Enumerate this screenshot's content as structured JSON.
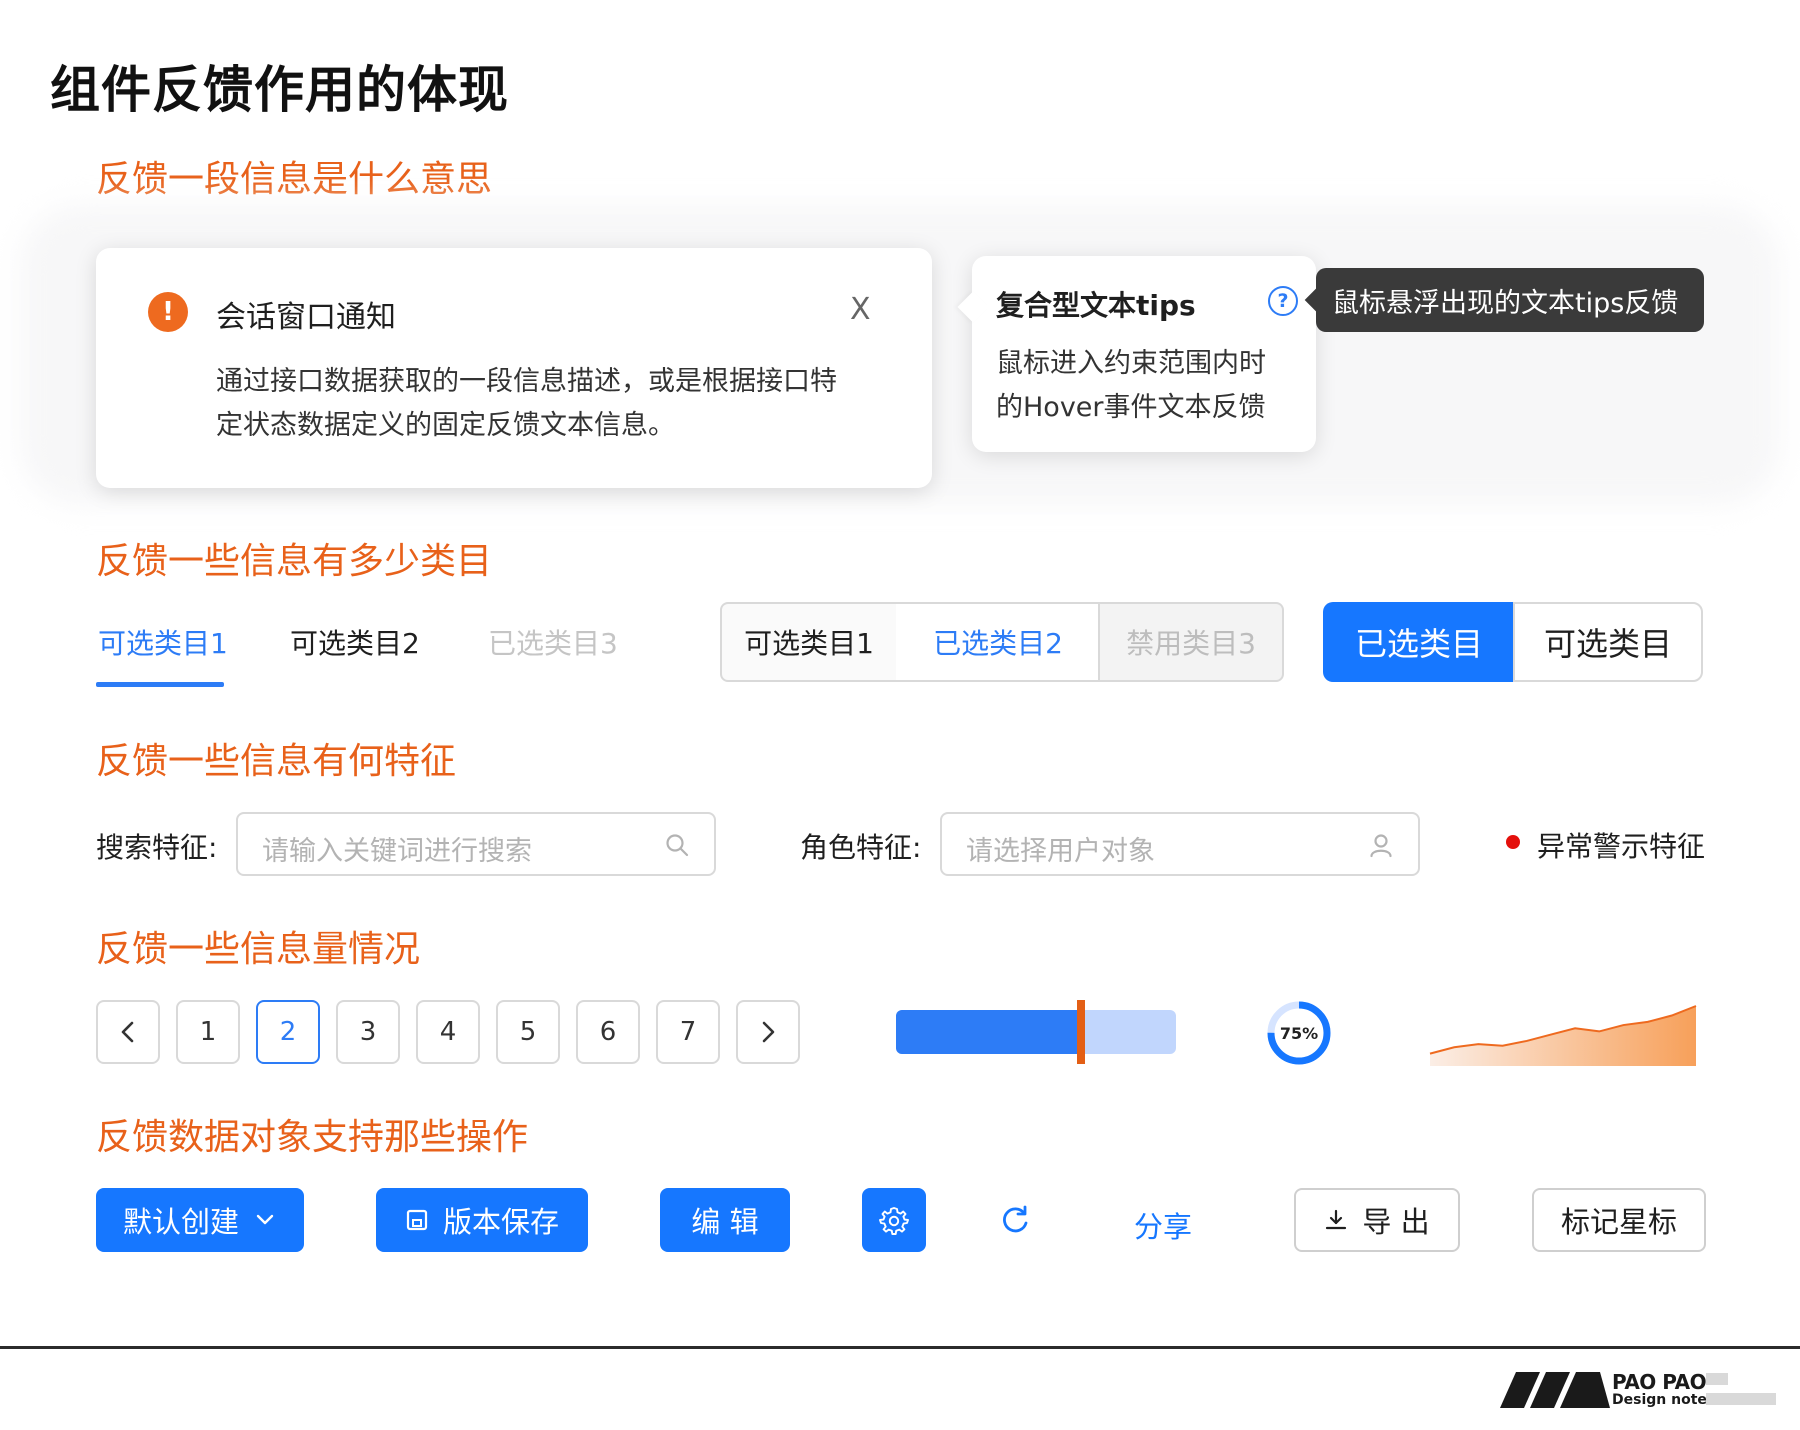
{
  "page_title": "组件反馈作用的体现",
  "sections": {
    "s1": "反馈一段信息是什么意思",
    "s2": "反馈一些信息有多少类目",
    "s3": "反馈一些信息有何特征",
    "s4": "反馈一些信息量情况",
    "s5": "反馈数据对象支持那些操作"
  },
  "notification": {
    "icon": "exclamation-icon",
    "icon_glyph": "!",
    "title": "会话窗口通知",
    "close_glyph": "X",
    "body_line1": "通过接口数据获取的一段信息描述，或是根据接口特",
    "body_line2": "定状态数据定义的固定反馈文本信息。"
  },
  "tip_card": {
    "title": "复合型文本tips",
    "help_glyph": "?",
    "body_line1": "鼠标进入约束范围内时",
    "body_line2": "的Hover事件文本反馈"
  },
  "hover_tooltip": "鼠标悬浮出现的文本tips反馈",
  "tabs": [
    {
      "label": "可选类目1",
      "state": "active"
    },
    {
      "label": "可选类目2",
      "state": "normal"
    },
    {
      "label": "已选类目3",
      "state": "disabled"
    }
  ],
  "segmented": [
    {
      "label": "可选类目1",
      "state": "normal"
    },
    {
      "label": "已选类目2",
      "state": "selected"
    },
    {
      "label": "禁用类目3",
      "state": "disabled"
    }
  ],
  "toggle": [
    {
      "label": "已选类目",
      "state": "selected"
    },
    {
      "label": "可选类目",
      "state": "normal"
    }
  ],
  "search": {
    "label": "搜索特征:",
    "placeholder": "请输入关键词进行搜索",
    "icon": "search-icon"
  },
  "role": {
    "label": "角色特征:",
    "placeholder": "请选择用户对象",
    "icon": "user-icon"
  },
  "alert_feature": {
    "label": "异常警示特征",
    "color": "#e4100c"
  },
  "pagination": {
    "prev_glyph": "<",
    "next_glyph": ">",
    "pages": [
      "1",
      "2",
      "3",
      "4",
      "5",
      "6",
      "7"
    ],
    "current": "2"
  },
  "progress": {
    "value_fraction": 0.66
  },
  "ring": {
    "label": "75%",
    "value": 75
  },
  "sparkline": {
    "values": [
      2,
      4,
      5,
      4.5,
      6,
      8,
      10,
      9,
      11,
      12,
      14,
      17
    ]
  },
  "actions": {
    "default_create": "默认创建",
    "save_version": "版本保存",
    "edit": "编 辑",
    "share": "分享",
    "export": "导 出",
    "star": "标记星标"
  },
  "colors": {
    "accent": "#1677ff",
    "heading": "#e8611a",
    "warning": "#ee6a1f",
    "alert": "#e4100c"
  },
  "logo": {
    "line1": "PAO PAO",
    "line2": "Design notes"
  }
}
